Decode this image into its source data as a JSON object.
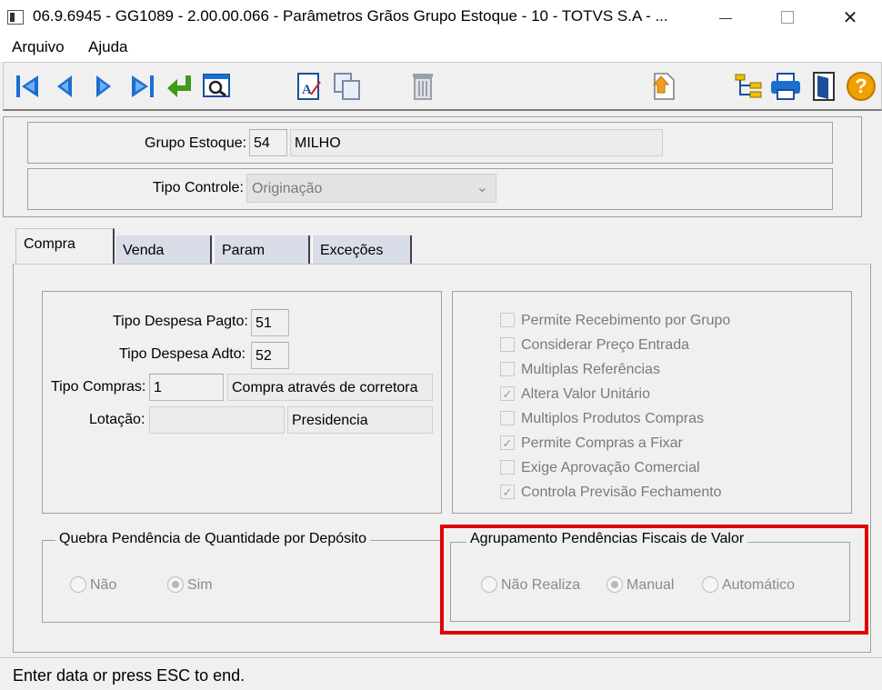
{
  "window": {
    "title": "06.9.6945 - GG1089 - 2.00.00.066 - Parâmetros Grãos Grupo Estoque - 10 - TOTVS S.A - ...",
    "min_glyph": "—",
    "close_glyph": "✕"
  },
  "menu": {
    "items": [
      {
        "label": "Arquivo"
      },
      {
        "label": "Ajuda"
      }
    ]
  },
  "toolbar": {
    "icons": [
      "first-record-icon",
      "prev-record-icon",
      "next-record-icon",
      "last-record-icon",
      "goto-icon",
      "search-icon",
      "edit-icon",
      "copy-icon",
      "delete-icon",
      "upload-icon",
      "tree-icon",
      "print-icon",
      "exit-icon",
      "help-icon"
    ],
    "help_glyph": "?"
  },
  "header": {
    "grupo_label": "Grupo Estoque:",
    "grupo_code": "54",
    "grupo_desc": "MILHO",
    "tipo_label": "Tipo Controle:",
    "tipo_value": "Originação",
    "combo_arrow": "⌄"
  },
  "tabs": [
    {
      "label": "Compra"
    },
    {
      "label": "Venda"
    },
    {
      "label": "Param"
    },
    {
      "label": "Exceções"
    }
  ],
  "compra": {
    "despesa_pagto_label": "Tipo Despesa Pagto:",
    "despesa_pagto_value": "51",
    "despesa_adto_label": "Tipo Despesa Adto:",
    "despesa_adto_value": "52",
    "tipo_compras_label": "Tipo Compras:",
    "tipo_compras_code": "1",
    "tipo_compras_desc": "Compra através de corretora",
    "lotacao_label": "Lotação:",
    "lotacao_code": "",
    "lotacao_desc": "Presidencia",
    "checkboxes": [
      {
        "label": "Permite Recebimento por Grupo",
        "checked": false
      },
      {
        "label": "Considerar Preço Entrada",
        "checked": false
      },
      {
        "label": "Multiplas Referências",
        "checked": false
      },
      {
        "label": "Altera Valor Unitário",
        "checked": true
      },
      {
        "label": "Multiplos Produtos Compras",
        "checked": false
      },
      {
        "label": "Permite Compras a Fixar",
        "checked": true
      },
      {
        "label": "Exige Aprovação Comercial",
        "checked": false
      },
      {
        "label": "Controla Previsão Fechamento",
        "checked": true
      }
    ],
    "check_glyph": "✓",
    "quebra": {
      "legend": "Quebra Pendência de Quantidade por Depósito",
      "options": [
        {
          "label": "Não",
          "selected": false
        },
        {
          "label": "Sim",
          "selected": true
        }
      ]
    },
    "agrupamento": {
      "legend": "Agrupamento Pendências Fiscais de Valor",
      "options": [
        {
          "label": "Não Realiza",
          "selected": false
        },
        {
          "label": "Manual",
          "selected": true
        },
        {
          "label": "Automático",
          "selected": false
        }
      ],
      "highlight_color": "#e00000"
    }
  },
  "status": {
    "text": "Enter data or press ESC to end."
  }
}
